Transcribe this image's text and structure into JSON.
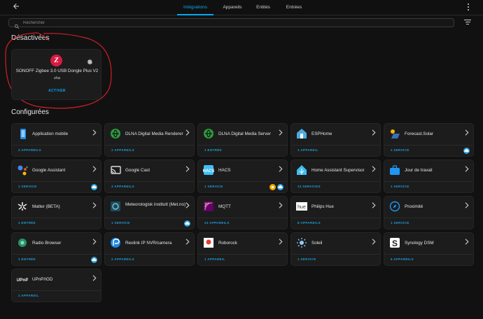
{
  "tabs": [
    "Intégrations",
    "Appareils",
    "Entités",
    "Entrées"
  ],
  "search": {
    "placeholder": "Rechercher"
  },
  "disabled_section": {
    "title": "Désactivées",
    "card": {
      "name": "SONOFF Zigbee 3.0 USB Dongle Plus V2",
      "sub": "zha",
      "action": "ACTIVER"
    }
  },
  "configured_section": {
    "title": "Configurées"
  },
  "cards": [
    {
      "name": "Application mobile",
      "footer": "2 APPAREILS",
      "icon": "phone-icon",
      "cloud": false
    },
    {
      "name": "DLNA Digital Media Renderer",
      "footer": "2 APPAREILS",
      "icon": "dlna-icon",
      "cloud": false
    },
    {
      "name": "DLNA Digital Media Server",
      "footer": "1 ENTRÉE",
      "icon": "dlna-icon",
      "cloud": false
    },
    {
      "name": "ESPHome",
      "footer": "1 APPAREIL",
      "icon": "esphome-icon",
      "cloud": false
    },
    {
      "name": "Forecast.Solar",
      "footer": "1 SERVICE",
      "icon": "solar-icon",
      "cloud": true
    },
    {
      "name": "Google Assistant",
      "footer": "1 SERVICE",
      "icon": "google-assistant-icon",
      "cloud": true
    },
    {
      "name": "Google Cast",
      "footer": "3 APPAREILS",
      "icon": "cast-icon",
      "cloud": false
    },
    {
      "name": "HACS",
      "footer": "1 SERVICE",
      "icon": "hacs-icon",
      "cloud": true,
      "custom": true
    },
    {
      "name": "Home Assistant Supervisor",
      "footer": "13 SERVICES",
      "icon": "home-assistant-icon",
      "cloud": false
    },
    {
      "name": "Jour de travail",
      "footer": "1 SERVICE",
      "icon": "briefcase-icon",
      "cloud": false
    },
    {
      "name": "Matter (BETA)",
      "footer": "1 ENTRÉE",
      "icon": "matter-icon",
      "cloud": false
    },
    {
      "name": "Meteorologisk institutt (Met.no)",
      "footer": "1 SERVICE",
      "icon": "met-icon",
      "cloud": true
    },
    {
      "name": "MQTT",
      "footer": "23 APPAREILS",
      "icon": "mqtt-icon",
      "cloud": false
    },
    {
      "name": "Philips Hue",
      "footer": "8 APPAREILS",
      "icon": "hue-icon",
      "cloud": false
    },
    {
      "name": "Proximité",
      "footer": "1 SERVICE",
      "icon": "compass-icon",
      "cloud": false
    },
    {
      "name": "Radio Browser",
      "footer": "1 ENTRÉE",
      "icon": "radio-icon",
      "cloud": true
    },
    {
      "name": "Reolink IP NVR/camera",
      "footer": "2 APPAREILS",
      "icon": "reolink-icon",
      "cloud": false
    },
    {
      "name": "Roborock",
      "footer": "1 APPAREIL",
      "icon": "roborock-icon",
      "cloud": false
    },
    {
      "name": "Soleil",
      "footer": "1 SERVICE",
      "icon": "sun-icon",
      "cloud": false
    },
    {
      "name": "Synology DSM",
      "footer": "6 APPAREILS",
      "icon": "synology-icon",
      "cloud": false
    },
    {
      "name": "UPnP/IGD",
      "footer": "1 APPAREIL",
      "icon": "upnp-icon",
      "cloud": false
    }
  ],
  "colors": {
    "accent": "#03a9f4",
    "background": "#111111",
    "card": "#1c1c1c",
    "annotation": "#d0202a"
  }
}
